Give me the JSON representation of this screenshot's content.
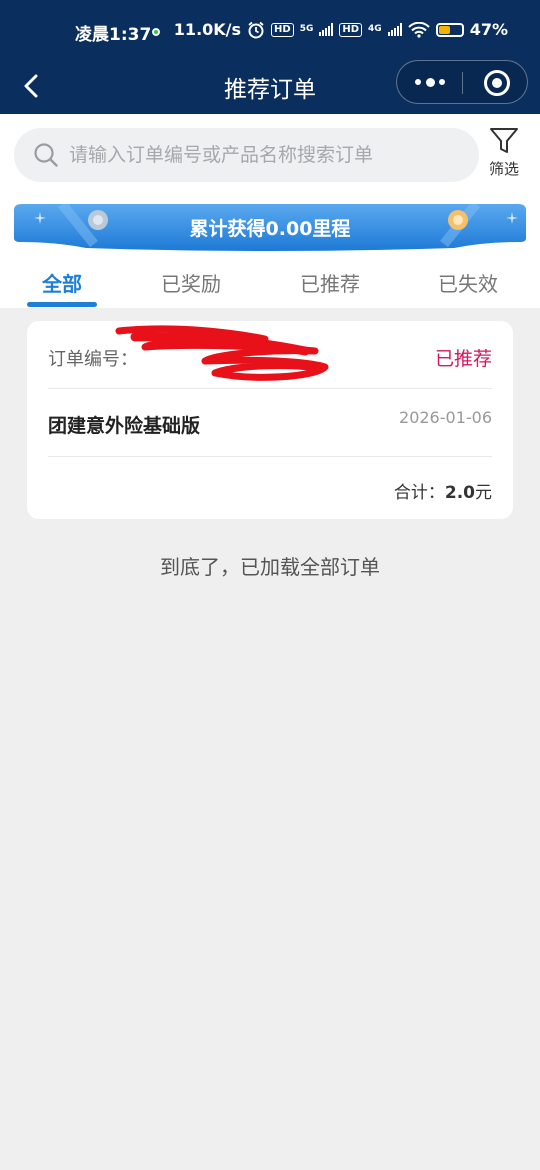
{
  "status_bar": {
    "time": "凌晨1:37",
    "net_speed": "11.0K/s",
    "hd1": "HD",
    "sig1": "5G",
    "hd2": "HD",
    "sig2": "4G",
    "battery": "47%"
  },
  "nav": {
    "title": "推荐订单"
  },
  "search": {
    "placeholder": "请输入订单编号或产品名称搜索订单",
    "value": ""
  },
  "filter": {
    "label": "筛选"
  },
  "banner": {
    "text": "累计获得0.00里程"
  },
  "tabs": [
    {
      "label": "全部",
      "active": true
    },
    {
      "label": "已奖励",
      "active": false
    },
    {
      "label": "已推荐",
      "active": false
    },
    {
      "label": "已失效",
      "active": false
    }
  ],
  "order": {
    "number_label": "订单编号：",
    "number_value": "（已涂抹）",
    "status": "已推荐",
    "product": "团建意外险基础版",
    "date": "2026-01-06",
    "total_label": "合计：",
    "total_value": "2.0",
    "total_unit": "元"
  },
  "footer": {
    "end_text": "到底了，已加载全部订单"
  },
  "colors": {
    "nav_bg": "#0a2e5e",
    "accent": "#1f7fd6",
    "status_pink": "#d4175e"
  }
}
